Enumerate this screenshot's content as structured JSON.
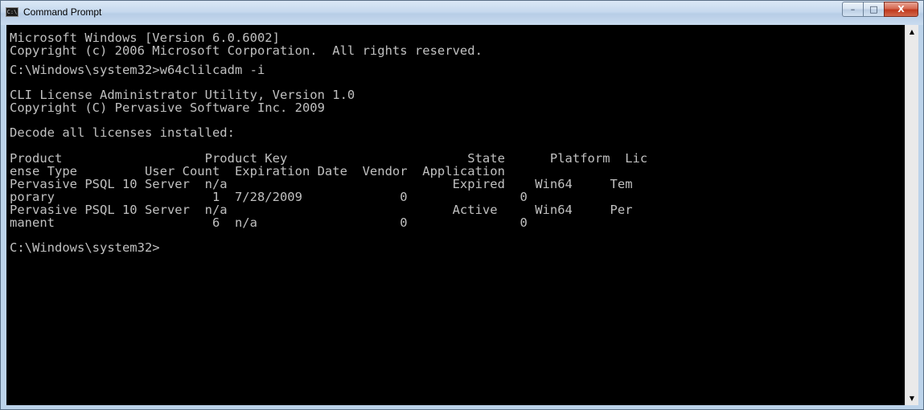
{
  "window": {
    "title": "Command Prompt",
    "app_icon_text": "C:\\"
  },
  "caption_buttons": {
    "minimize": "–",
    "maximize": "□",
    "close": "X"
  },
  "console": {
    "lines": [
      "Microsoft Windows [Version 6.0.6002]",
      "Copyright (c) 2006 Microsoft Corporation.  All rights reserved.",
      "C:\\Windows\\system32>w64clilcadm -i",
      "CLI License Administrator Utility, Version 1.0",
      "Copyright (C) Pervasive Software Inc. 2009",
      "Decode all licenses installed:",
      "Product                   Product Key                        State      Platform  Lic",
      "ense Type         User Count  Expiration Date  Vendor  Application",
      "Pervasive PSQL 10 Server  n/a                              Expired    Win64     Tem",
      "porary                     1  7/28/2009             0               0",
      "Pervasive PSQL 10 Server  n/a                              Active     Win64     Per",
      "manent                     6  n/a                   0               0",
      "C:\\Windows\\system32>"
    ]
  },
  "scrollbar": {
    "up_arrow": "▲",
    "down_arrow": "▼"
  },
  "colors": {
    "console_bg": "#000000",
    "console_text": "#c0c0c0",
    "frame": "#bcd3ea",
    "close_button": "#c0391d"
  }
}
